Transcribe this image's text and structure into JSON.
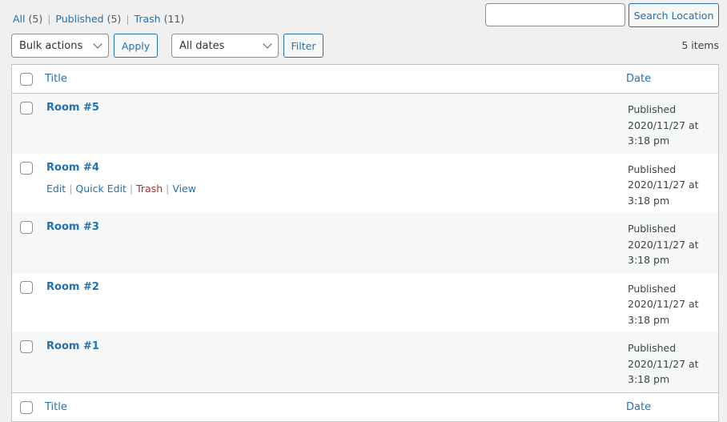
{
  "views": [
    {
      "label": "All",
      "count": "(5)"
    },
    {
      "label": "Published",
      "count": "(5)"
    },
    {
      "label": "Trash",
      "count": "(11)"
    }
  ],
  "search": {
    "value": "",
    "button": "Search Location"
  },
  "bulk": {
    "selected": "Bulk actions",
    "apply": "Apply"
  },
  "dates": {
    "selected": "All dates",
    "filter": "Filter"
  },
  "item_count": "5 items",
  "columns": {
    "title": "Title",
    "date": "Date"
  },
  "row_actions": {
    "edit": "Edit",
    "quick_edit": "Quick Edit",
    "trash": "Trash",
    "view": "View"
  },
  "rows": [
    {
      "title": "Room #5",
      "status": "Published",
      "date": "2020/11/27 at",
      "time": "3:18 pm"
    },
    {
      "title": "Room #4",
      "status": "Published",
      "date": "2020/11/27 at",
      "time": "3:18 pm"
    },
    {
      "title": "Room #3",
      "status": "Published",
      "date": "2020/11/27 at",
      "time": "3:18 pm"
    },
    {
      "title": "Room #2",
      "status": "Published",
      "date": "2020/11/27 at",
      "time": "3:18 pm"
    },
    {
      "title": "Room #1",
      "status": "Published",
      "date": "2020/11/27 at",
      "time": "3:18 pm"
    }
  ]
}
